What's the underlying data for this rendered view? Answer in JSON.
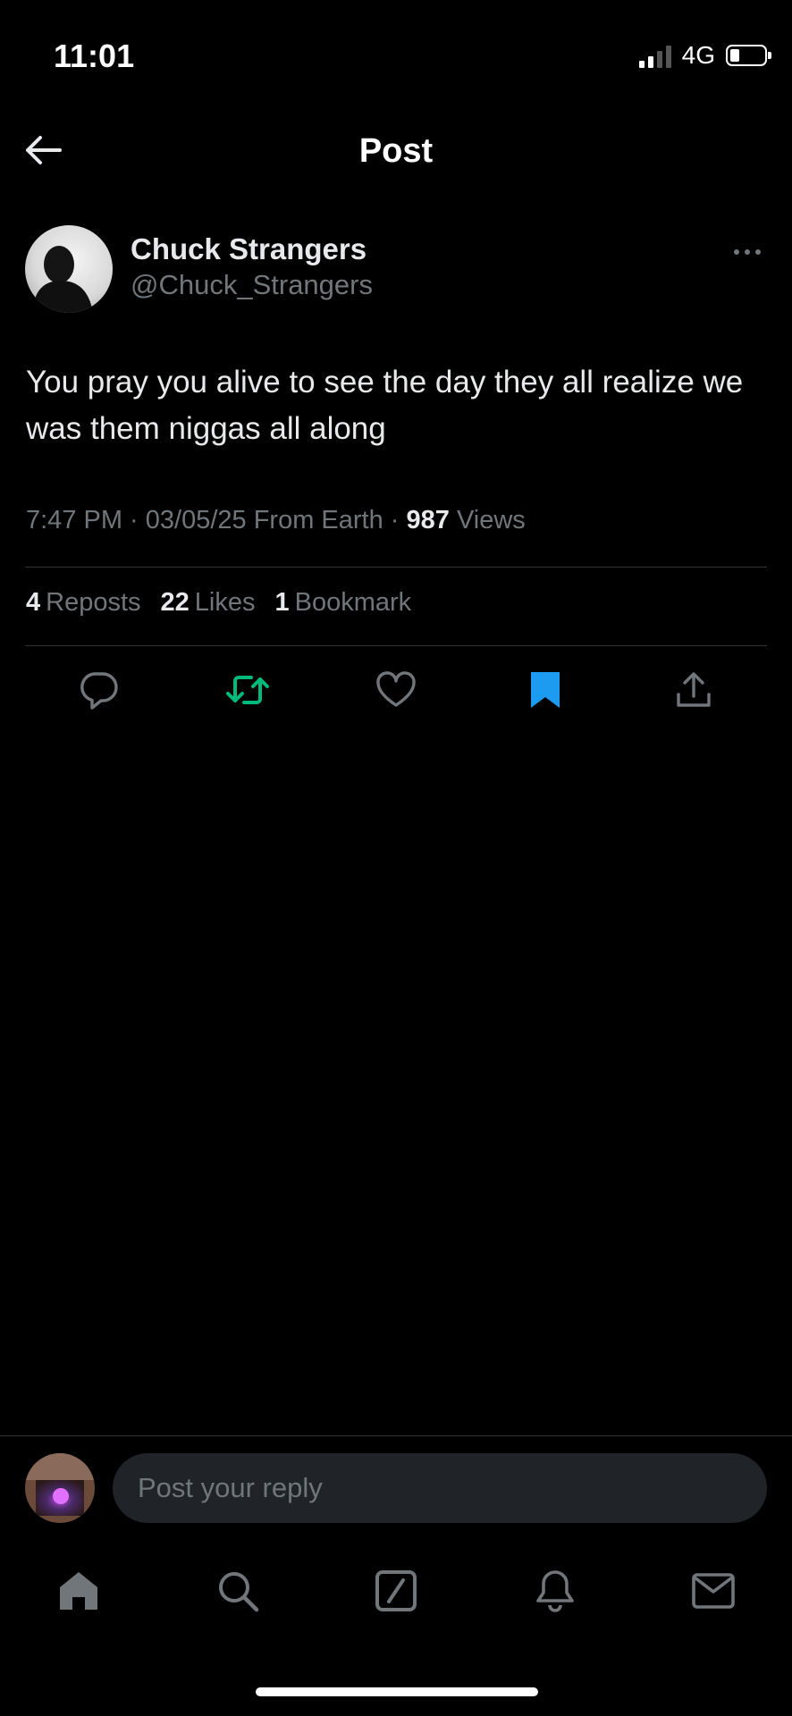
{
  "status_bar": {
    "time": "11:01",
    "network": "4G"
  },
  "header": {
    "title": "Post"
  },
  "author": {
    "name": "Chuck Strangers",
    "handle": "@Chuck_Strangers"
  },
  "post": {
    "text": "You pray you alive to see the day they all realize we was them niggas all along",
    "timestamp": "7:47 PM · 03/05/25 From Earth · ",
    "views_count": "987",
    "views_label": " Views"
  },
  "stats": {
    "reposts_count": "4",
    "reposts_label": "Reposts",
    "likes_count": "22",
    "likes_label": "Likes",
    "bookmarks_count": "1",
    "bookmarks_label": "Bookmark"
  },
  "colors": {
    "repost_active": "#00ba7c",
    "bookmark_active": "#1d9bf0",
    "muted": "#71767b"
  },
  "reply": {
    "placeholder": "Post your reply"
  },
  "nav": {
    "items": [
      "home-icon",
      "search-icon",
      "grok-icon",
      "notifications-icon",
      "messages-icon"
    ]
  }
}
